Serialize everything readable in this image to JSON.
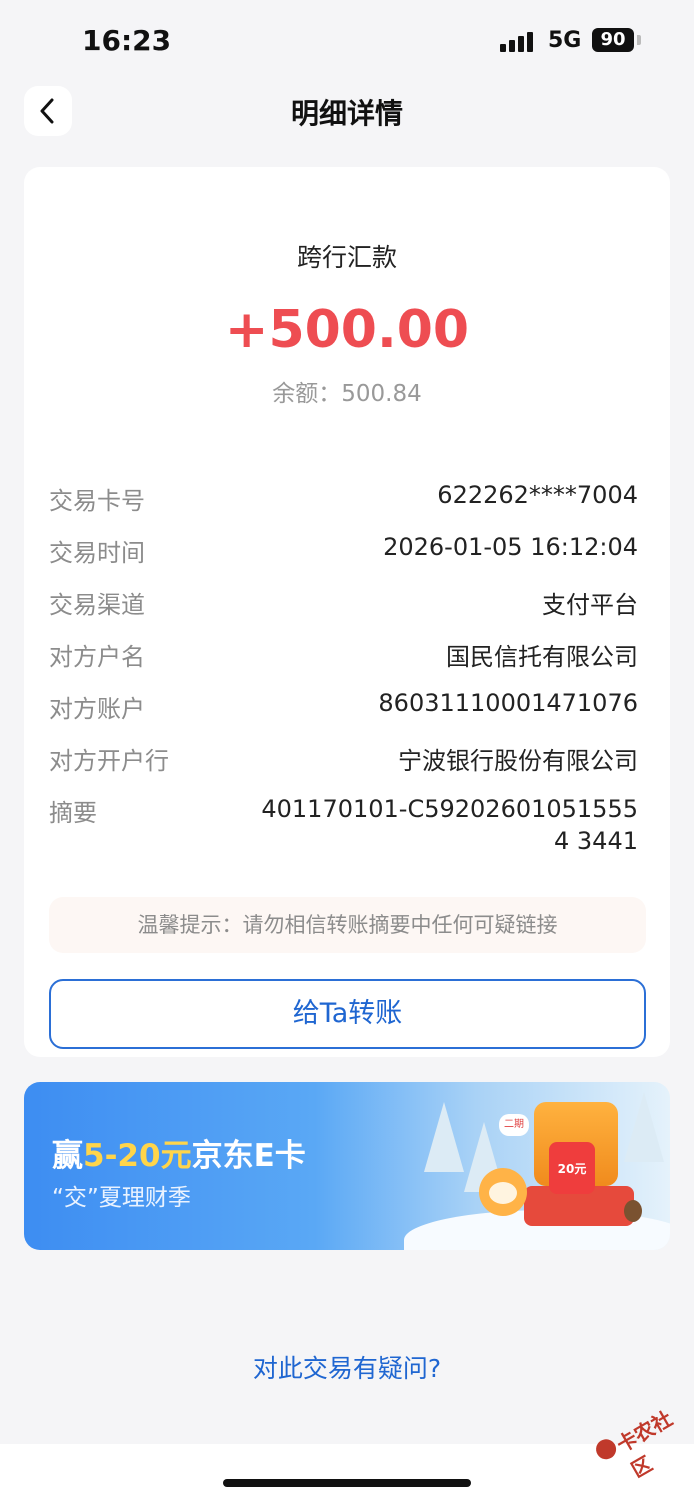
{
  "status_bar": {
    "time": "16:23",
    "network": "5G",
    "battery": "90"
  },
  "nav": {
    "title": "明细详情"
  },
  "transaction": {
    "type": "跨行汇款",
    "amount": "+500.00",
    "balance": "余额：500.84",
    "amount_color": "#ee4d52"
  },
  "details": {
    "card_no_label": "交易卡号",
    "card_no": "622262****7004",
    "time_label": "交易时间",
    "time": "2026-01-05 16:12:04",
    "channel_label": "交易渠道",
    "channel": "支付平台",
    "payer_name_label": "对方户名",
    "payer_name": "国民信托有限公司",
    "payer_account_label": "对方账户",
    "payer_account": "86031110001471076",
    "payer_bank_label": "对方开户行",
    "payer_bank": "宁波银行股份有限公司",
    "memo_label": "摘要",
    "memo": "401170101-C592026010515554 3441"
  },
  "tip": "温馨提示：请勿相信转账摘要中任何可疑链接",
  "transfer_button": "给Ta转账",
  "banner": {
    "title_prefix": "赢",
    "title_highlight": "5-20元",
    "title_suffix": "京东E卡",
    "subtitle": "“交”夏理财季",
    "badge": "20元",
    "bubble": "二期"
  },
  "question_link": "对此交易有疑问?",
  "watermark": "卡农社区",
  "colors": {
    "link": "#1f66d1",
    "accent_red": "#ee4d52",
    "banner_highlight": "#ffd54a"
  }
}
